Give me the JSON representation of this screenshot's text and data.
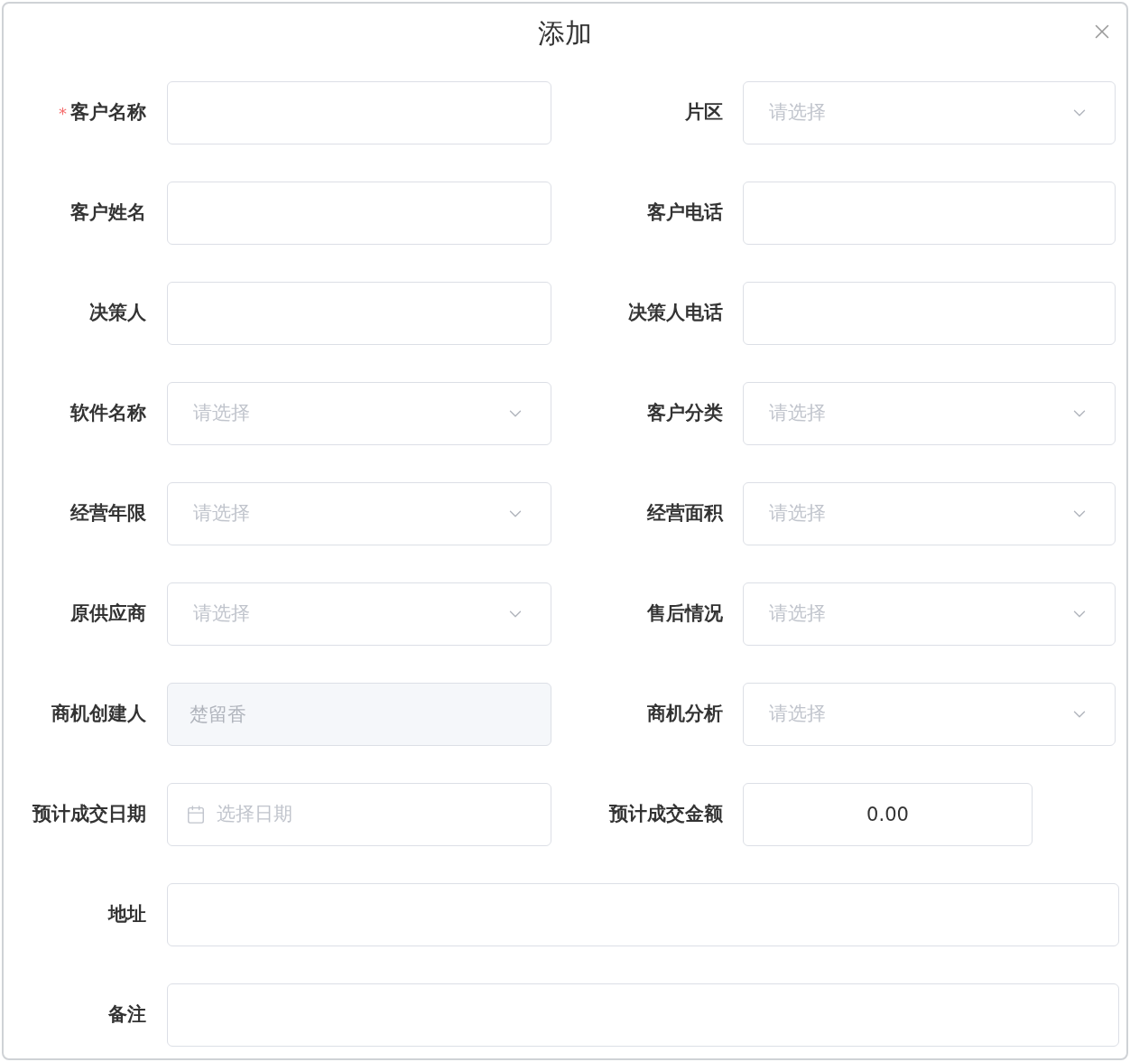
{
  "dialog": {
    "title": "添加"
  },
  "rows": [
    {
      "fields": [
        {
          "label": "客户名称",
          "required_mark": "*",
          "kind": "text"
        },
        {
          "label": "片区",
          "kind": "select",
          "placeholder": "请选择"
        }
      ]
    },
    {
      "fields": [
        {
          "label": "客户姓名",
          "kind": "text"
        },
        {
          "label": "客户电话",
          "kind": "text"
        }
      ]
    },
    {
      "fields": [
        {
          "label": "决策人",
          "kind": "text"
        },
        {
          "label": "决策人电话",
          "kind": "text"
        }
      ]
    },
    {
      "fields": [
        {
          "label": "软件名称",
          "kind": "select",
          "placeholder": "请选择"
        },
        {
          "label": "客户分类",
          "kind": "select",
          "placeholder": "请选择"
        }
      ]
    },
    {
      "fields": [
        {
          "label": "经营年限",
          "kind": "select",
          "placeholder": "请选择"
        },
        {
          "label": "经营面积",
          "kind": "select",
          "placeholder": "请选择"
        }
      ]
    },
    {
      "fields": [
        {
          "label": "原供应商",
          "kind": "select",
          "placeholder": "请选择"
        },
        {
          "label": "售后情况",
          "kind": "select",
          "placeholder": "请选择"
        }
      ]
    },
    {
      "fields": [
        {
          "label": "商机创建人",
          "kind": "text",
          "value": "楚留香",
          "disabled": true
        },
        {
          "label": "商机分析",
          "kind": "select",
          "placeholder": "请选择"
        }
      ]
    },
    {
      "fields": [
        {
          "label": "预计成交日期",
          "kind": "date",
          "placeholder": "选择日期"
        },
        {
          "label": "预计成交金额",
          "kind": "number",
          "value": "0.00"
        }
      ]
    },
    {
      "fields": [
        {
          "label": "地址",
          "kind": "text"
        }
      ]
    },
    {
      "fields": [
        {
          "label": "备注",
          "kind": "text"
        }
      ]
    }
  ]
}
